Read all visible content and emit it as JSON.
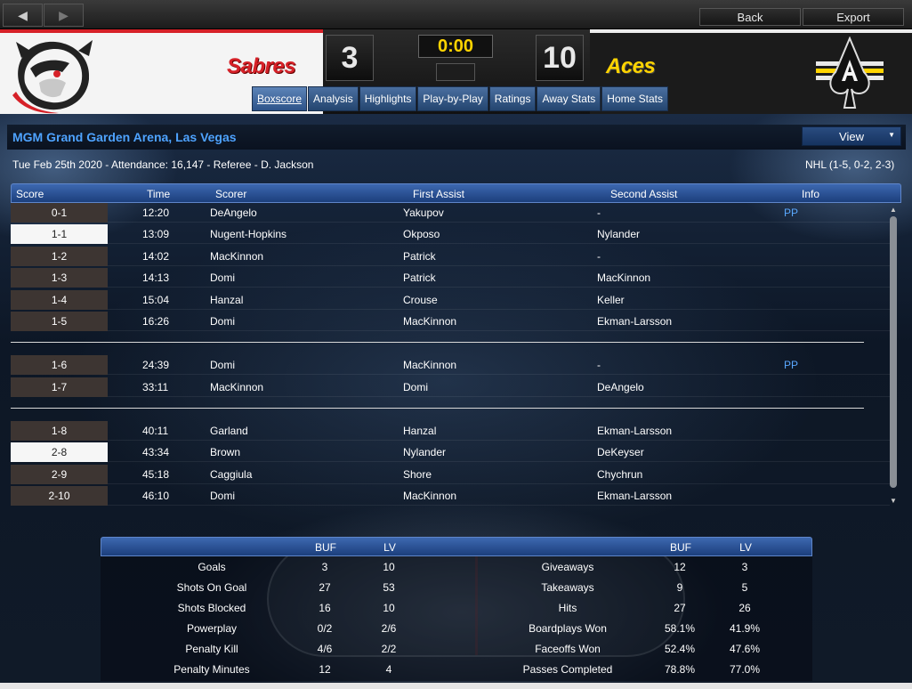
{
  "toolbar": {
    "back_arrow": "◀",
    "forward_arrow": "▶",
    "back_label": "Back",
    "export_label": "Export"
  },
  "scoreboard": {
    "home_team": "Sabres",
    "away_team": "Aces",
    "home_score": "3",
    "away_score": "10",
    "clock": "0:00",
    "home_color": "#d62128",
    "away_color": "#ffd400"
  },
  "tabs": [
    "Boxscore",
    "Analysis",
    "Highlights",
    "Play-by-Play",
    "Ratings",
    "Away Stats",
    "Home Stats"
  ],
  "arena": {
    "name": "MGM Grand Garden Arena, Las Vegas",
    "view_label": "View",
    "game_info": "Tue Feb 25th 2020 - Attendance: 16,147 - Referee - D. Jackson",
    "series": "NHL (1-5, 0-2, 2-3)"
  },
  "goals": {
    "headers": [
      "Score",
      "Time",
      "Scorer",
      "First Assist",
      "Second Assist",
      "Info"
    ],
    "periods": [
      [
        {
          "score": "0-1",
          "time": "12:20",
          "scorer": "DeAngelo",
          "a1": "Yakupov",
          "a2": "-",
          "info": "PP",
          "highlight": false
        },
        {
          "score": "1-1",
          "time": "13:09",
          "scorer": "Nugent-Hopkins",
          "a1": "Okposo",
          "a2": "Nylander",
          "info": "",
          "highlight": true
        },
        {
          "score": "1-2",
          "time": "14:02",
          "scorer": "MacKinnon",
          "a1": "Patrick",
          "a2": "-",
          "info": "",
          "highlight": false
        },
        {
          "score": "1-3",
          "time": "14:13",
          "scorer": "Domi",
          "a1": "Patrick",
          "a2": "MacKinnon",
          "info": "",
          "highlight": false
        },
        {
          "score": "1-4",
          "time": "15:04",
          "scorer": "Hanzal",
          "a1": "Crouse",
          "a2": "Keller",
          "info": "",
          "highlight": false
        },
        {
          "score": "1-5",
          "time": "16:26",
          "scorer": "Domi",
          "a1": "MacKinnon",
          "a2": "Ekman-Larsson",
          "info": "",
          "highlight": false
        }
      ],
      [
        {
          "score": "1-6",
          "time": "24:39",
          "scorer": "Domi",
          "a1": "MacKinnon",
          "a2": "-",
          "info": "PP",
          "highlight": false
        },
        {
          "score": "1-7",
          "time": "33:11",
          "scorer": "MacKinnon",
          "a1": "Domi",
          "a2": "DeAngelo",
          "info": "",
          "highlight": false
        }
      ],
      [
        {
          "score": "1-8",
          "time": "40:11",
          "scorer": "Garland",
          "a1": "Hanzal",
          "a2": "Ekman-Larsson",
          "info": "",
          "highlight": false
        },
        {
          "score": "2-8",
          "time": "43:34",
          "scorer": "Brown",
          "a1": "Nylander",
          "a2": "DeKeyser",
          "info": "",
          "highlight": true
        },
        {
          "score": "2-9",
          "time": "45:18",
          "scorer": "Caggiula",
          "a1": "Shore",
          "a2": "Chychrun",
          "info": "",
          "highlight": false
        },
        {
          "score": "2-10",
          "time": "46:10",
          "scorer": "Domi",
          "a1": "MacKinnon",
          "a2": "Ekman-Larsson",
          "info": "",
          "highlight": false
        }
      ]
    ]
  },
  "stats": {
    "header_left": [
      "BUF",
      "LV"
    ],
    "header_right": [
      "BUF",
      "LV"
    ],
    "left": [
      {
        "label": "Goals",
        "buf": "3",
        "lv": "10"
      },
      {
        "label": "Shots On Goal",
        "buf": "27",
        "lv": "53"
      },
      {
        "label": "Shots Blocked",
        "buf": "16",
        "lv": "10"
      },
      {
        "label": "Powerplay",
        "buf": "0/2",
        "lv": "2/6"
      },
      {
        "label": "Penalty Kill",
        "buf": "4/6",
        "lv": "2/2"
      },
      {
        "label": "Penalty Minutes",
        "buf": "12",
        "lv": "4"
      }
    ],
    "right": [
      {
        "label": "Giveaways",
        "buf": "12",
        "lv": "3"
      },
      {
        "label": "Takeaways",
        "buf": "9",
        "lv": "5"
      },
      {
        "label": "Hits",
        "buf": "27",
        "lv": "26"
      },
      {
        "label": "Boardplays Won",
        "buf": "58.1%",
        "lv": "41.9%"
      },
      {
        "label": "Faceoffs Won",
        "buf": "52.4%",
        "lv": "47.6%"
      },
      {
        "label": "Passes Completed",
        "buf": "78.8%",
        "lv": "77.0%"
      }
    ]
  }
}
